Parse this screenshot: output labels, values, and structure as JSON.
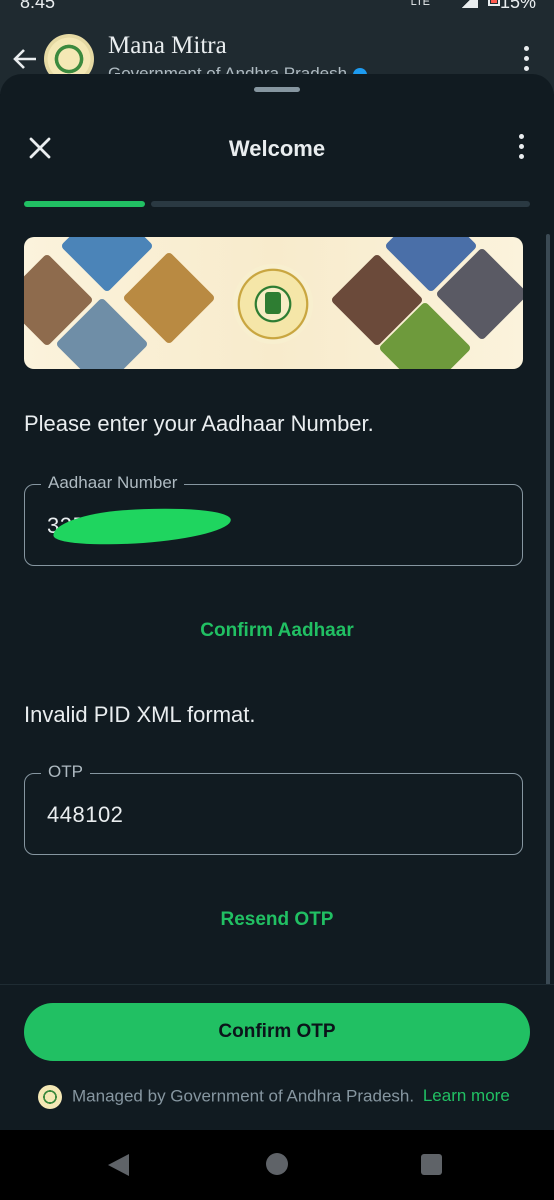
{
  "status_bar": {
    "time": "8:45",
    "network": "LTE",
    "battery": "15%"
  },
  "chat_header": {
    "name": "Mana Mitra",
    "subtitle": "Government of Andhra Pradesh",
    "icons": [
      "back-arrow-icon",
      "verified-badge-icon",
      "more-vert-icon"
    ]
  },
  "sheet": {
    "title": "Welcome",
    "progress": {
      "step": 1,
      "total_steps": 4
    },
    "prompt": "Please enter your Aadhaar Number.",
    "aadhaar": {
      "label": "Aadhaar Number",
      "value": "325"
    },
    "confirm_aadhaar_label": "Confirm Aadhaar",
    "error_message": "Invalid PID XML format.",
    "otp": {
      "label": "OTP",
      "value": "448102"
    },
    "resend_label": "Resend OTP",
    "cta_label": "Confirm OTP",
    "managed_text": "Managed by Government of Andhra Pradesh.",
    "learn_more_label": "Learn more"
  },
  "colors": {
    "accent": "#21c063",
    "background": "#111b21",
    "text": "#e9edef",
    "muted": "#8696a0"
  }
}
